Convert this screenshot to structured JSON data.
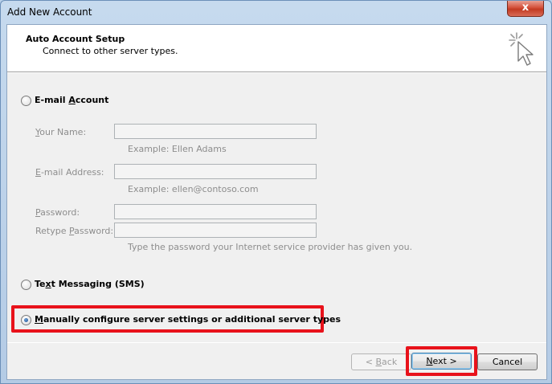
{
  "window": {
    "title": "Add New Account",
    "close_label": "x"
  },
  "header": {
    "title": "Auto Account Setup",
    "subtitle": "Connect to other server types.",
    "icon": "cursor-click-icon"
  },
  "options": {
    "email": {
      "label_pre": "E-mail ",
      "label_u": "A",
      "label_post": "ccount",
      "selected": false
    },
    "sms": {
      "label_pre": "Te",
      "label_u": "x",
      "label_post": "t Messaging (SMS)",
      "selected": false
    },
    "manual": {
      "label_pre": "",
      "label_u": "M",
      "label_post": "anually configure server settings or additional server types",
      "selected": true
    }
  },
  "fields": {
    "your_name": {
      "label_u": "Y",
      "label_post": "our Name:",
      "value": "",
      "hint": "Example: Ellen Adams"
    },
    "email_address": {
      "label_u": "E",
      "label_post": "-mail Address:",
      "value": "",
      "hint": "Example: ellen@contoso.com"
    },
    "password": {
      "label_u": "P",
      "label_post": "assword:",
      "value": ""
    },
    "retype_password": {
      "label_pre": "Retype ",
      "label_u": "P",
      "label_post": "assword:",
      "value": "",
      "hint": "Type the password your Internet service provider has given you."
    }
  },
  "buttons": {
    "back": {
      "label_pre": "< ",
      "label_u": "B",
      "label_post": "ack"
    },
    "next": {
      "label_u": "N",
      "label_post": "ext >"
    },
    "cancel": {
      "label": "Cancel"
    }
  },
  "colors": {
    "highlight": "#e8121b",
    "disabled_text": "#8d8d8d"
  }
}
